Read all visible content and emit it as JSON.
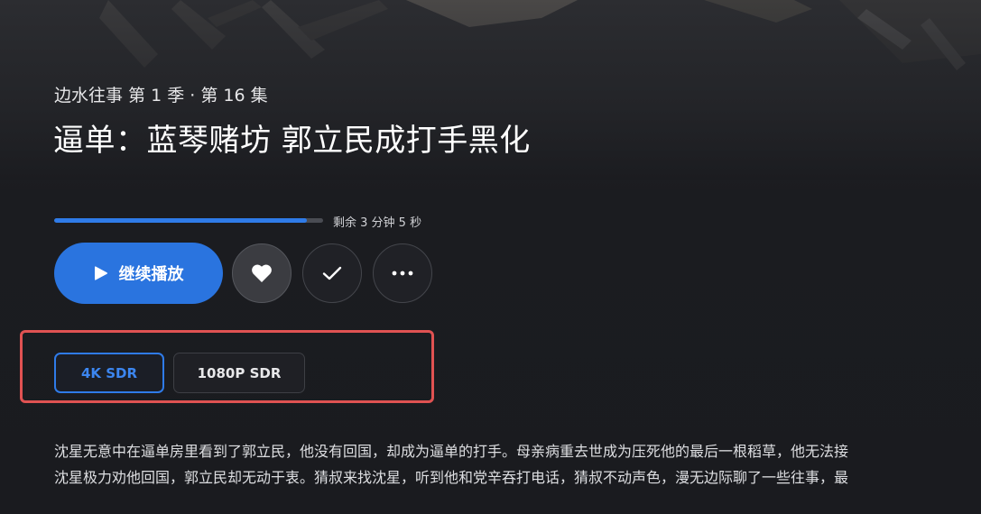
{
  "episode": {
    "series_line": "边水往事 第 1 季 · 第 16 集",
    "title": "逼单：蓝琴赌坊 郭立民成打手黑化"
  },
  "playback": {
    "progress_fraction": 0.94,
    "remaining_text": "剩余 3 分钟 5 秒"
  },
  "actions": {
    "play_label": "继续播放",
    "play_icon": "play-icon",
    "favorite_icon": "heart-icon",
    "watched_icon": "check-icon",
    "more_icon": "more-icon"
  },
  "quality": {
    "options": [
      "4K SDR",
      "1080P SDR"
    ],
    "selected": "4K SDR"
  },
  "description": {
    "line1": "沈星无意中在逼单房里看到了郭立民，他没有回国，却成为逼单的打手。母亲病重去世成为压死他的最后一根稻草，他无法接",
    "line2": "沈星极力劝他回国，郭立民却无动于衷。猜叔来找沈星，听到他和党辛吞打电话，猜叔不动声色，漫无边际聊了一些往事，最"
  },
  "colors": {
    "accent": "#2a74df",
    "highlight_border": "#e05252",
    "background": "#1b1c20"
  }
}
